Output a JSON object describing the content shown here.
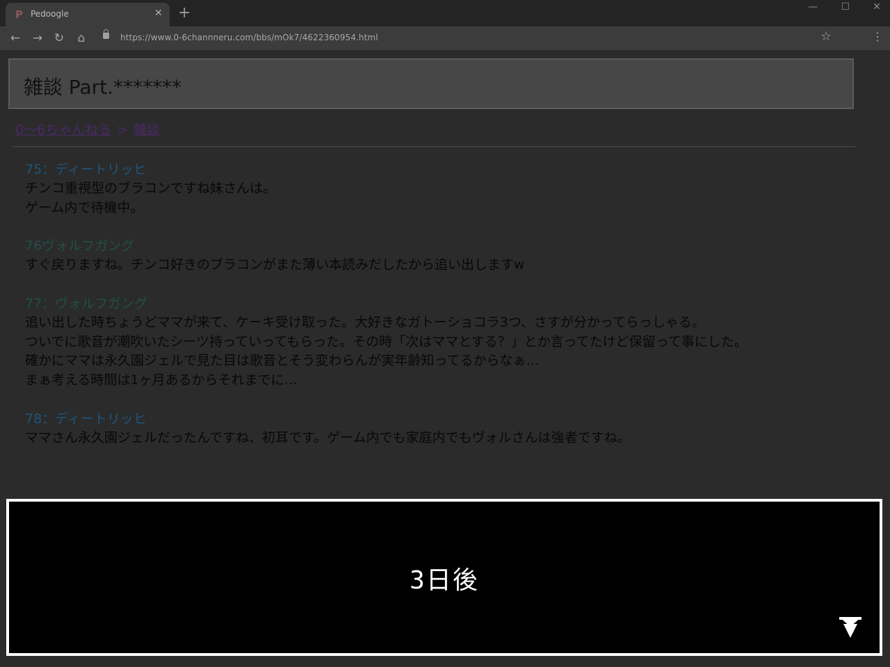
{
  "browser": {
    "tab_title": "Pedoogle",
    "tab_favicon": "P",
    "tab_close": "✕",
    "new_tab": "+",
    "url": "https://www.0-6channneru.com/bbs/mOk7/4622360954.html",
    "window_controls": {
      "minimize": "—",
      "maximize": "☐",
      "close": "✕"
    },
    "nav": {
      "back": "←",
      "forward": "→",
      "reload": "↻",
      "home": "⌂",
      "bookmark": "☆",
      "menu": "⋮"
    }
  },
  "page": {
    "title": "雑談 Part.*******",
    "breadcrumb": {
      "home": "0～6ちゃんねる",
      "separator": ">",
      "current": "雑談"
    }
  },
  "posts": [
    {
      "header": "75：ディートリッヒ",
      "lines": [
        "チンコ重視型のブラコンですね妹さんは。",
        "ゲーム内で待機中。"
      ]
    },
    {
      "header": "76ヴォルフガング",
      "lines": [
        "すぐ戻りますね。チンコ好きのブラコンがまた薄い本読みだしたから追い出しますw"
      ]
    },
    {
      "header": "77：ヴォルフガング",
      "lines": [
        "追い出した時ちょうどママが来て、ケーキ受け取った。大好きなガトーショコラ3つ、さすが分かってらっしゃる。",
        "ついでに歌音が潮吹いたシーツ持っていってもらった。その時「次はママとする？」とか言ってたけど保留って事にした。",
        "確かにママは永久園ジェルで見た目は歌音とそう変わらんが実年齢知ってるからなぁ…",
        "まぁ考える時間は1ヶ月あるからそれまでに…"
      ]
    },
    {
      "header": "78：ディートリッヒ",
      "lines": [
        "ママさん永久園ジェルだったんですね、初耳です。ゲーム内でも家庭内でもヴォルさんは強者ですね。"
      ]
    }
  ],
  "dialog": {
    "text": "3日後",
    "advance_icon": "advance-arrow-icon"
  },
  "colors": {
    "overlay_bg": "#2b2b2c",
    "dialog_bg": "#000000",
    "dialog_border": "#ffffff",
    "post_header_blue": "#1f5577",
    "post_header_teal": "#214f44"
  }
}
